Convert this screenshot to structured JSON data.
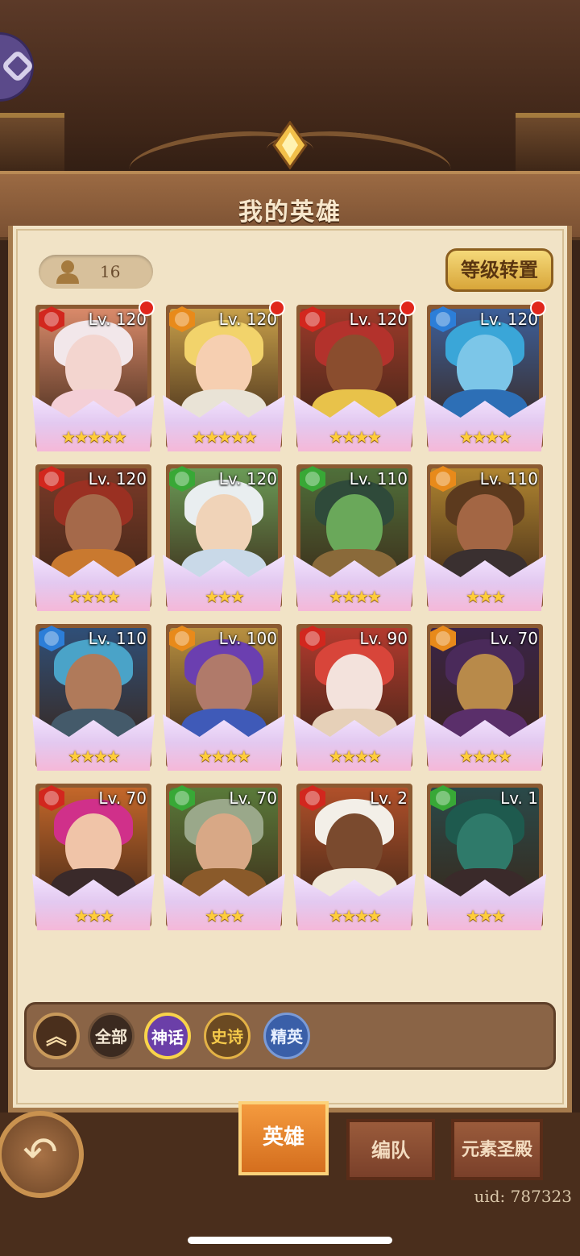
{
  "header": {
    "title": "我的英雄"
  },
  "hero_count": "16",
  "reset_button": "等级转置",
  "heroes": [
    {
      "level": "Lv. 120",
      "element": "fire",
      "stars": 5,
      "new": true,
      "skin": "#f3d5cf",
      "hair": "#f2e7ea",
      "bg": "#d98a6a",
      "outfit": "#f4cfd6"
    },
    {
      "level": "Lv. 120",
      "element": "light",
      "stars": 5,
      "new": true,
      "skin": "#f6cfb1",
      "hair": "#f2d36b",
      "bg": "#c8a04a",
      "outfit": "#e9e3d6"
    },
    {
      "level": "Lv. 120",
      "element": "fire",
      "stars": 4,
      "new": true,
      "skin": "#8a4d2e",
      "hair": "#b3322c",
      "bg": "#9c3a2a",
      "outfit": "#e8c24a"
    },
    {
      "level": "Lv. 120",
      "element": "water",
      "stars": 4,
      "new": true,
      "skin": "#7cc6e8",
      "hair": "#3aa6d8",
      "bg": "#3c5f9a",
      "outfit": "#2d6fb6"
    },
    {
      "level": "Lv. 120",
      "element": "fire",
      "stars": 4,
      "new": false,
      "skin": "#a5694a",
      "hair": "#9a3022",
      "bg": "#7b3a28",
      "outfit": "#c9792f"
    },
    {
      "level": "Lv. 120",
      "element": "wind",
      "stars": 3,
      "new": false,
      "skin": "#f0d3b8",
      "hair": "#e9eef0",
      "bg": "#6a9a56",
      "outfit": "#c9d9e8"
    },
    {
      "level": "Lv. 110",
      "element": "wind",
      "stars": 4,
      "new": false,
      "skin": "#6aa85a",
      "hair": "#2f4a3a",
      "bg": "#4f6f3a",
      "outfit": "#8a6a3a"
    },
    {
      "level": "Lv. 110",
      "element": "light",
      "stars": 3,
      "new": false,
      "skin": "#a36644",
      "hair": "#5c3a1e",
      "bg": "#b08530",
      "outfit": "#3a3030"
    },
    {
      "level": "Lv. 110",
      "element": "water",
      "stars": 4,
      "new": false,
      "skin": "#b07a5a",
      "hair": "#4aa3c8",
      "bg": "#2f4f78",
      "outfit": "#445a6a"
    },
    {
      "level": "Lv. 100",
      "element": "light",
      "stars": 4,
      "new": false,
      "skin": "#b07a6a",
      "hair": "#6b3fb0",
      "bg": "#b89040",
      "outfit": "#3f5ab8"
    },
    {
      "level": "Lv. 90",
      "element": "fire",
      "stars": 4,
      "new": false,
      "skin": "#f3e2dc",
      "hair": "#d8453a",
      "bg": "#b33a2e",
      "outfit": "#e6d0b8"
    },
    {
      "level": "Lv. 70",
      "element": "light",
      "stars": 4,
      "new": false,
      "skin": "#b88a4a",
      "hair": "#4a2a5a",
      "bg": "#3a2448",
      "outfit": "#5a2f6a"
    },
    {
      "level": "Lv. 70",
      "element": "fire",
      "stars": 3,
      "new": false,
      "skin": "#f0c4a8",
      "hair": "#d0308a",
      "bg": "#c4672a",
      "outfit": "#3a2a2a"
    },
    {
      "level": "Lv. 70",
      "element": "wind",
      "stars": 3,
      "new": false,
      "skin": "#d8a886",
      "hair": "#9aa88a",
      "bg": "#5a7a3a",
      "outfit": "#8a5a2a"
    },
    {
      "level": "Lv. 2",
      "element": "fire",
      "stars": 4,
      "new": false,
      "skin": "#7a4a2e",
      "hair": "#f3efe8",
      "bg": "#b0502a",
      "outfit": "#f0e8d8"
    },
    {
      "level": "Lv. 1",
      "element": "wind",
      "stars": 3,
      "new": false,
      "skin": "#2f7a6a",
      "hair": "#1e5a4e",
      "bg": "#2a4a4a",
      "outfit": "#3a2a2a"
    }
  ],
  "filters": {
    "collapse_icon": "chevron-up-icon",
    "all": "全部",
    "mythic": "神话",
    "epic": "史诗",
    "elite": "精英"
  },
  "tabs": {
    "heroes": "英雄",
    "team": "编队",
    "shrine": "元素圣殿"
  },
  "back_icon": "back-arrow-icon",
  "uid": "uid: 787323",
  "colors": {
    "element_fire": "#d2271e",
    "element_light": "#e88a1a",
    "element_water": "#2c7ed8",
    "element_wind": "#38a836",
    "active_tab": "#f0852a"
  }
}
